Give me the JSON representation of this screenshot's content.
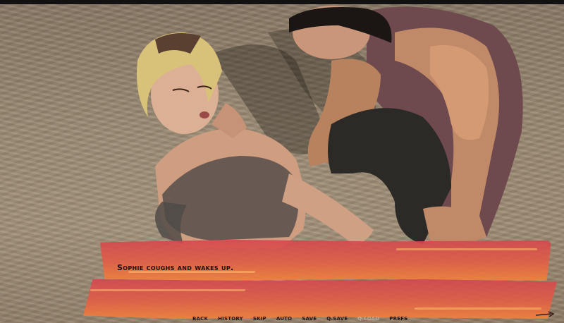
{
  "dialogue": {
    "text": "Sophie coughs and wakes up."
  },
  "quick_menu": [
    {
      "label": "Back",
      "dim": false
    },
    {
      "label": "History",
      "dim": false
    },
    {
      "label": "Skip",
      "dim": false
    },
    {
      "label": "Auto",
      "dim": false
    },
    {
      "label": "Save",
      "dim": false
    },
    {
      "label": "Q.Save",
      "dim": false
    },
    {
      "label": "Q.Load",
      "dim": true
    },
    {
      "label": "Prefs",
      "dim": false
    }
  ],
  "colors": {
    "sand": "#9b8a73",
    "dialogue_panel": "#e25e46",
    "text": "#1b0f0f"
  }
}
